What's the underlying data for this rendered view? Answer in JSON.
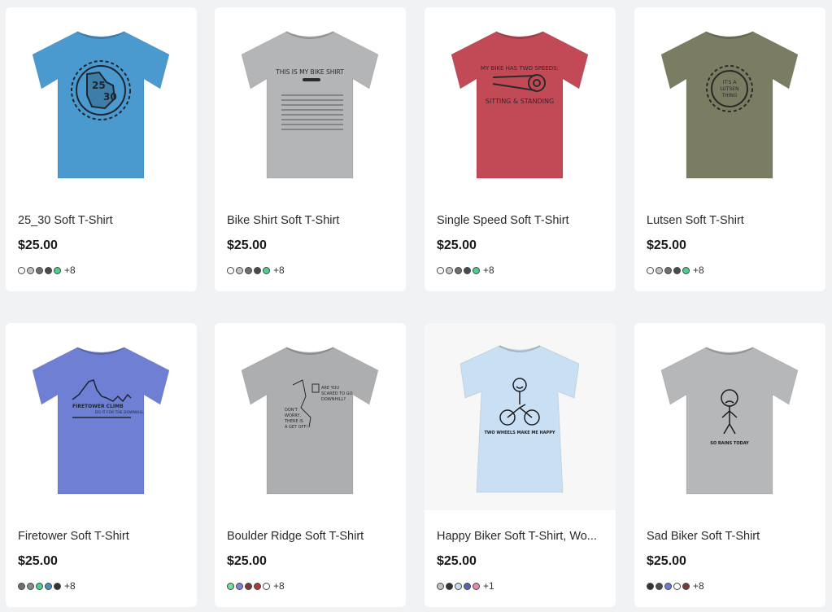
{
  "products": [
    {
      "title": "25_30 Soft T-Shirt",
      "price": "$25.00",
      "color": "#4a9ad0",
      "graphic": "bike-gear-graphic",
      "graphic_text": [
        "25",
        "30"
      ],
      "swatches": [
        "#ffffff",
        "#c4c4c4",
        "#6f6f6f",
        "#4b4b4b",
        "#4ccf8f"
      ],
      "more": "+8"
    },
    {
      "title": "Bike Shirt Soft T-Shirt",
      "price": "$25.00",
      "color": "#b4b5b7",
      "graphic": "bike-table-graphic",
      "graphic_text": [
        "THIS IS MY BIKE SHIRT"
      ],
      "swatches": [
        "#ffffff",
        "#c4c4c4",
        "#6f6f6f",
        "#4b4b4b",
        "#4ccf8f"
      ],
      "more": "+8"
    },
    {
      "title": "Single Speed Soft T-Shirt",
      "price": "$25.00",
      "color": "#c24a57",
      "graphic": "chain-graphic",
      "graphic_text": [
        "MY BIKE HAS TWO SPEEDS:",
        "SITTING & STANDING"
      ],
      "swatches": [
        "#ffffff",
        "#c4c4c4",
        "#6f6f6f",
        "#4b4b4b",
        "#4ccf8f"
      ],
      "more": "+8"
    },
    {
      "title": "Lutsen Soft T-Shirt",
      "price": "$25.00",
      "color": "#7a7d62",
      "graphic": "gear-graphic",
      "graphic_text": [
        "IT'S A",
        "LUTSEN",
        "THING"
      ],
      "swatches": [
        "#ffffff",
        "#c4c4c4",
        "#6f6f6f",
        "#4b4b4b",
        "#4ccf8f"
      ],
      "more": "+8"
    },
    {
      "title": "Firetower Soft T-Shirt",
      "price": "$25.00",
      "color": "#6e7fd4",
      "graphic": "elevation-graphic",
      "graphic_text": [
        "FIRETOWER CLIMB",
        "DO IT FOR THE DOWNHILL"
      ],
      "swatches": [
        "#6f6f6f",
        "#8a8a8a",
        "#4ccf8f",
        "#4a8fbf",
        "#333333"
      ],
      "more": "+8"
    },
    {
      "title": "Boulder Ridge Soft T-Shirt",
      "price": "$25.00",
      "color": "#adaeb0",
      "graphic": "rock-graphic",
      "graphic_text": [
        "ARE YOU",
        "SCARED TO GO",
        "DOWNHILL?",
        "DON'T",
        "WORRY,",
        "THERE IS",
        "A GET OFF!"
      ],
      "swatches": [
        "#6ee09a",
        "#7a85d6",
        "#7a3a3a",
        "#b03a3a",
        "#ffffff"
      ],
      "more": "+8"
    },
    {
      "title": "Happy Biker Soft T-Shirt, Wo...",
      "price": "$25.00",
      "color": "#c9e0f4",
      "graphic": "happy-biker-graphic",
      "graphic_text": [
        "TWO WHEELS MAKE ME HAPPY"
      ],
      "swatches": [
        "#c4c4c4",
        "#333333",
        "#c9e0f4",
        "#5a5fb8",
        "#e88ab0"
      ],
      "more": "+1"
    },
    {
      "title": "Sad Biker Soft T-Shirt",
      "price": "$25.00",
      "color": "#b6b7b9",
      "graphic": "sad-biker-graphic",
      "graphic_text": [
        "SO RAINS TODAY"
      ],
      "swatches": [
        "#333333",
        "#4b4b4b",
        "#6b7bd8",
        "#ffffff",
        "#7a3a3a"
      ],
      "more": "+8"
    }
  ]
}
